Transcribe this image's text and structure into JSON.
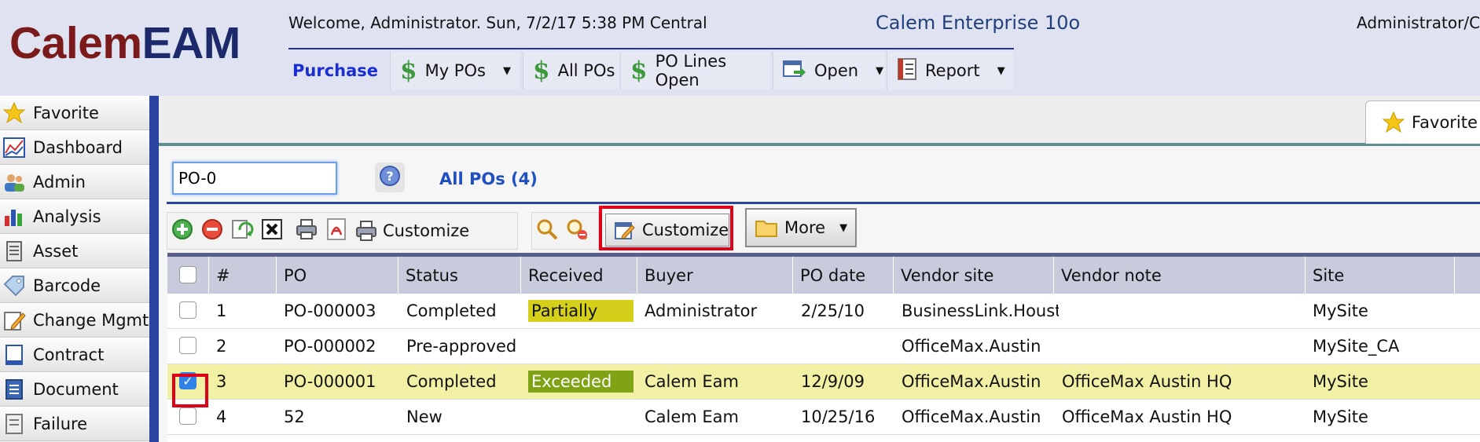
{
  "header": {
    "logo_part1": "Calem",
    "logo_part2": "EAM",
    "welcome": "Welcome, Administrator. Sun, 7/2/17 5:38 PM Central",
    "product": "Calem Enterprise 10o",
    "user_info": "Administrator/Cu",
    "module": "Purchase",
    "nav": [
      {
        "label": "My POs",
        "icon": "dollar-icon",
        "dropdown": true
      },
      {
        "label": "All POs",
        "icon": "dollar-icon",
        "dropdown": false
      },
      {
        "label": "PO Lines Open",
        "icon": "dollar-icon",
        "dropdown": false
      },
      {
        "label": "Open",
        "icon": "open-window-icon",
        "dropdown": true
      },
      {
        "label": "Report",
        "icon": "report-icon",
        "dropdown": true
      }
    ]
  },
  "sidebar": {
    "items": [
      {
        "label": "Favorite",
        "icon": "star-icon"
      },
      {
        "label": "Dashboard",
        "icon": "dashboard-icon"
      },
      {
        "label": "Admin",
        "icon": "users-icon"
      },
      {
        "label": "Analysis",
        "icon": "bar-chart-icon"
      },
      {
        "label": "Asset",
        "icon": "asset-icon"
      },
      {
        "label": "Barcode",
        "icon": "barcode-tag-icon"
      },
      {
        "label": "Change Mgmt",
        "icon": "pencil-icon"
      },
      {
        "label": "Contract",
        "icon": "contract-icon"
      },
      {
        "label": "Document",
        "icon": "document-icon"
      },
      {
        "label": "Failure",
        "icon": "failure-icon"
      }
    ]
  },
  "tabs": {
    "favorite": "Favorite"
  },
  "search": {
    "value": "PO-0",
    "list_title": "All POs (4)"
  },
  "toolbar": {
    "customize_print_label": "Customize",
    "customize_label": "Customize",
    "more_label": "More"
  },
  "grid": {
    "columns": [
      "#",
      "PO",
      "Status",
      "Received",
      "Buyer",
      "PO date",
      "Vendor site",
      "Vendor note",
      "Site"
    ],
    "rows": [
      {
        "num": "1",
        "po": "PO-000003",
        "status": "Completed",
        "received": "Partially",
        "buyer": "Administrator",
        "po_date": "2/25/10",
        "vendor_site": "BusinessLink.Houst…",
        "vendor_note": "",
        "site": "MySite",
        "checked": false
      },
      {
        "num": "2",
        "po": "PO-000002",
        "status": "Pre-approved",
        "received": "",
        "buyer": "",
        "po_date": "",
        "vendor_site": "OfficeMax.Austin",
        "vendor_note": "",
        "site": "MySite_CA",
        "checked": false
      },
      {
        "num": "3",
        "po": "PO-000001",
        "status": "Completed",
        "received": "Exceeded",
        "buyer": "Calem Eam",
        "po_date": "12/9/09",
        "vendor_site": "OfficeMax.Austin",
        "vendor_note": "OfficeMax Austin HQ",
        "site": "MySite",
        "checked": true
      },
      {
        "num": "4",
        "po": "52",
        "status": "New",
        "received": "",
        "buyer": "Calem Eam",
        "po_date": "10/25/16",
        "vendor_site": "OfficeMax.Austin",
        "vendor_note": "OfficeMax Austin HQ",
        "site": "MySite",
        "checked": false
      }
    ]
  },
  "colors": {
    "partially_badge": "#d4cf1b",
    "exceeded_badge": "#7fa315",
    "selected_row": "#f1f0a5",
    "highlight": "#e0001a"
  }
}
